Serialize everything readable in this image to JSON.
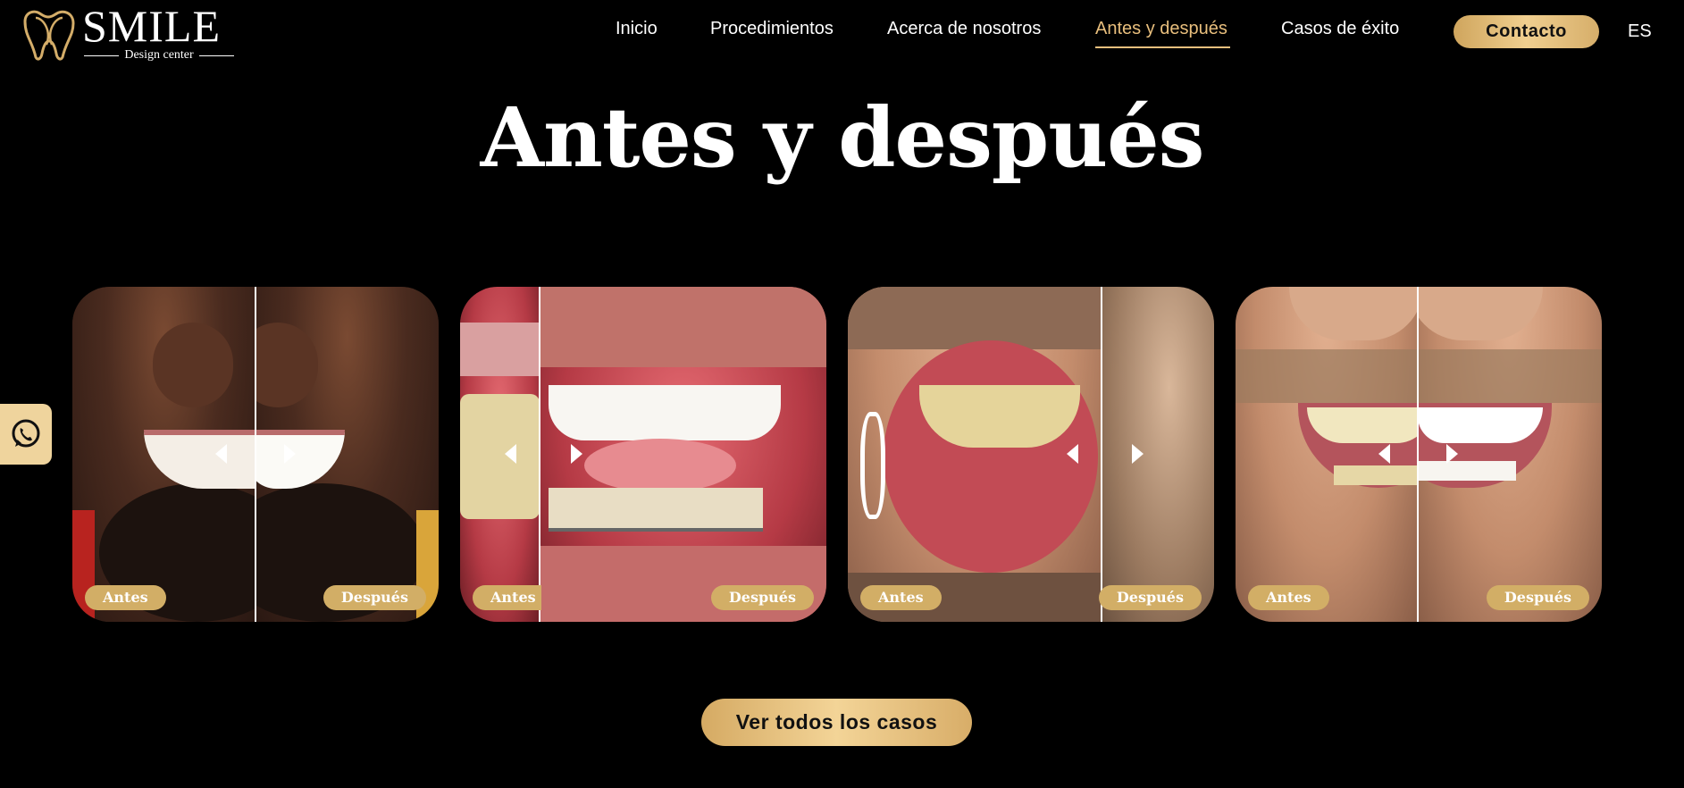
{
  "brand": {
    "name": "SMILE",
    "tagline": "Design center"
  },
  "nav": {
    "items": [
      {
        "label": "Inicio"
      },
      {
        "label": "Procedimientos"
      },
      {
        "label": "Acerca de nosotros"
      },
      {
        "label": "Antes y después",
        "active": true
      },
      {
        "label": "Casos de éxito"
      }
    ],
    "contact_label": "Contacto",
    "language": "ES"
  },
  "page": {
    "title": "Antes y después"
  },
  "gallery": {
    "cards": [
      {
        "before_label": "Antes",
        "after_label": "Después"
      },
      {
        "before_label": "Antes",
        "after_label": "Después"
      },
      {
        "before_label": "Antes",
        "after_label": "Después"
      },
      {
        "before_label": "Antes",
        "after_label": "Después"
      }
    ]
  },
  "cta": {
    "label": "Ver todos los casos"
  },
  "colors": {
    "accent": "#e9bf7d",
    "gold": "#d2ae66",
    "background": "#000000"
  },
  "icons": {
    "whatsapp": "whatsapp-icon",
    "logo": "tooth-logo-icon"
  }
}
